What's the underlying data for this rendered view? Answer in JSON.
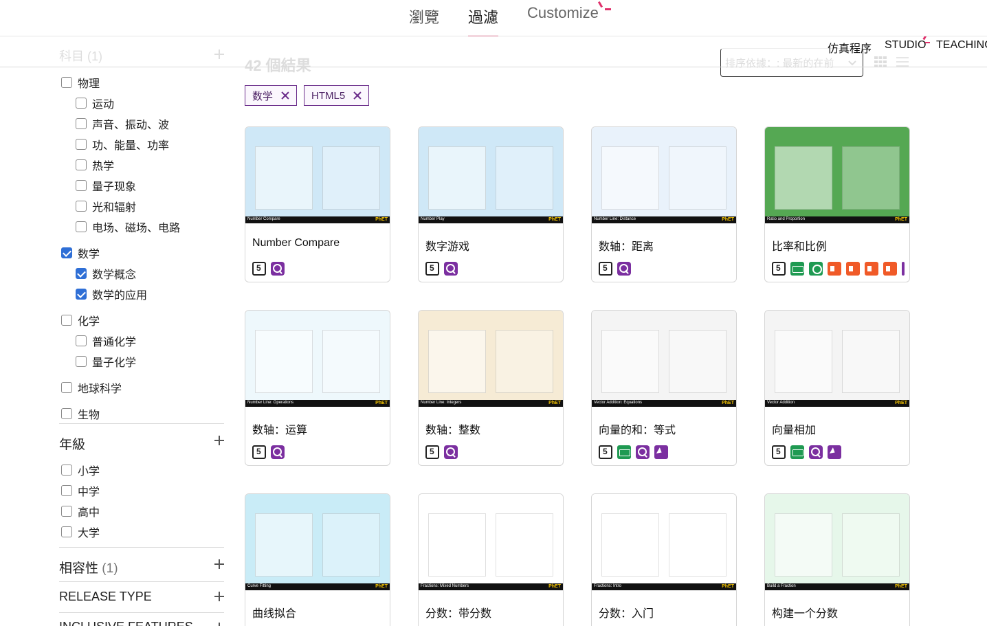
{
  "top_tabs": {
    "browse": "瀏覽",
    "filter": "過濾",
    "customize": "Customize"
  },
  "header_nav": {
    "simulations": "仿真程序",
    "studio": "STUDIO",
    "teaching": "TEACHING"
  },
  "sidebar": {
    "subject_header": "科目 (1)",
    "subjects": [
      {
        "label": "物理",
        "checked": false,
        "sub": false
      },
      {
        "label": "运动",
        "checked": false,
        "sub": true
      },
      {
        "label": "声音、振动、波",
        "checked": false,
        "sub": true
      },
      {
        "label": "功、能量、功率",
        "checked": false,
        "sub": true
      },
      {
        "label": "热学",
        "checked": false,
        "sub": true
      },
      {
        "label": "量子现象",
        "checked": false,
        "sub": true
      },
      {
        "label": "光和辐射",
        "checked": false,
        "sub": true
      },
      {
        "label": "电场、磁场、电路",
        "checked": false,
        "sub": true
      },
      {
        "label": "数学",
        "checked": true,
        "sub": false
      },
      {
        "label": "数学概念",
        "checked": true,
        "sub": true
      },
      {
        "label": "数学的应用",
        "checked": true,
        "sub": true
      },
      {
        "label": "化学",
        "checked": false,
        "sub": false
      },
      {
        "label": "普通化学",
        "checked": false,
        "sub": true
      },
      {
        "label": "量子化学",
        "checked": false,
        "sub": true
      },
      {
        "label": "地球科学",
        "checked": false,
        "sub": false
      },
      {
        "label": "生物",
        "checked": false,
        "sub": false
      }
    ],
    "grade_header": "年級",
    "grades": [
      {
        "label": "小学",
        "checked": false
      },
      {
        "label": "中学",
        "checked": false
      },
      {
        "label": "高中",
        "checked": false
      },
      {
        "label": "大学",
        "checked": false
      }
    ],
    "compat_header": "相容性",
    "compat_count": "(1)",
    "release_header": "RELEASE TYPE",
    "inclusive_header": "INCLUSIVE FEATURES"
  },
  "results": {
    "title": "42 個結果",
    "sort_label": "排序依據：: 最新的在前",
    "chips": [
      "数学",
      "HTML5"
    ]
  },
  "cards": [
    {
      "title": "Number Compare",
      "thumb_color": "#cfe8f7",
      "bar_label": "Number Compare",
      "badges": [
        "html5",
        "zoom"
      ]
    },
    {
      "title": "数字游戏",
      "thumb_color": "#cfe8f7",
      "bar_label": "Number Play",
      "badges": [
        "html5",
        "zoom"
      ]
    },
    {
      "title": "数轴：距离",
      "thumb_color": "#e9f2fb",
      "bar_label": "Number Line: Distance",
      "badges": [
        "html5",
        "zoom"
      ]
    },
    {
      "title": "比率和比例",
      "thumb_color": "#55a853",
      "bar_label": "Ratio and Proportion",
      "badges": [
        "html5",
        "keyboard",
        "voice",
        "sound",
        "sound",
        "sound",
        "sound",
        "edge"
      ]
    },
    {
      "title": "数轴：运算",
      "thumb_color": "#eef8fc",
      "bar_label": "Number Line: Operations",
      "badges": [
        "html5",
        "zoom"
      ]
    },
    {
      "title": "数轴：整数",
      "thumb_color": "#f6ebd5",
      "bar_label": "Number Line: Integers",
      "badges": [
        "html5",
        "zoom"
      ]
    },
    {
      "title": "向量的和：等式",
      "thumb_color": "#f4f4f4",
      "bar_label": "Vector Addition: Equations",
      "badges": [
        "html5",
        "keyboard",
        "zoom",
        "pointer"
      ]
    },
    {
      "title": "向量相加",
      "thumb_color": "#f4f4f4",
      "bar_label": "Vector Addition",
      "badges": [
        "html5",
        "keyboard",
        "zoom",
        "pointer"
      ]
    },
    {
      "title": "曲线拟合",
      "thumb_color": "#c9ecf7",
      "bar_label": "Curve Fitting",
      "badges": []
    },
    {
      "title": "分数：带分数",
      "thumb_color": "#ffffff",
      "bar_label": "Fractions: Mixed Numbers",
      "badges": []
    },
    {
      "title": "分数：入门",
      "thumb_color": "#ffffff",
      "bar_label": "Fractions: Intro",
      "badges": []
    },
    {
      "title": "构建一个分数",
      "thumb_color": "#e6f7ea",
      "bar_label": "Build a Fraction",
      "badges": []
    }
  ]
}
